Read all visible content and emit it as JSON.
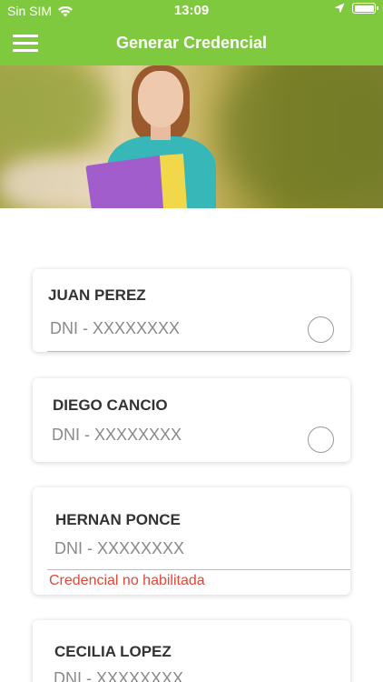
{
  "status_bar": {
    "carrier": "Sin SIM",
    "time": "13:09"
  },
  "header": {
    "title": "Generar Credencial",
    "menu_icon": "hamburger-menu-icon",
    "color": "#7fc93f"
  },
  "credentials": [
    {
      "name": "JUAN PEREZ",
      "dni": "DNI - XXXXXXXX",
      "selected": false
    },
    {
      "name": "DIEGO CANCIO",
      "dni": "DNI - XXXXXXXX",
      "selected": false
    },
    {
      "name": "HERNAN PONCE",
      "dni": "DNI - XXXXXXXX",
      "status": "Credencial no habilitada"
    },
    {
      "name": "CECILIA LOPEZ",
      "dni": "DNI - XXXXXXXX"
    }
  ],
  "colors": {
    "warning": "#e2473a",
    "text": "#333333",
    "muted": "#8a8a8a"
  }
}
